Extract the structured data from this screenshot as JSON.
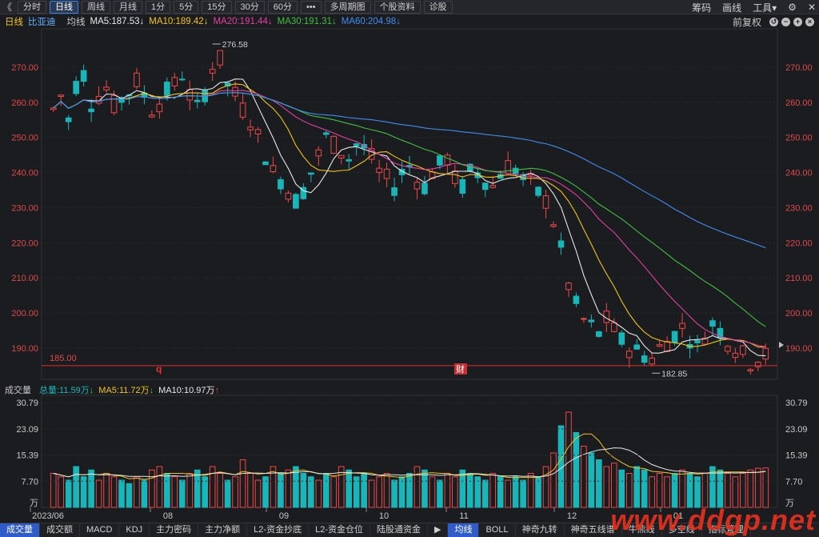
{
  "toolbar": {
    "back": "《",
    "tabs": [
      {
        "label": "分时",
        "active": false
      },
      {
        "label": "日线",
        "active": true
      },
      {
        "label": "周线",
        "active": false
      },
      {
        "label": "月线",
        "active": false
      },
      {
        "label": "1分",
        "active": false
      },
      {
        "label": "5分",
        "active": false
      },
      {
        "label": "15分",
        "active": false
      },
      {
        "label": "30分",
        "active": false
      },
      {
        "label": "60分",
        "active": false
      },
      {
        "label": "•••",
        "active": false
      },
      {
        "label": "多周期图",
        "active": false
      },
      {
        "label": "个股资料",
        "active": false
      },
      {
        "label": "诊股",
        "active": false
      }
    ],
    "right": [
      "筹码",
      "画线",
      "工具▾"
    ],
    "settings_icon": "gear-icon",
    "close_icon": "close-icon"
  },
  "ma_bar": {
    "period": "日线",
    "stock": "比亚迪",
    "avg_label": "均线",
    "items": [
      {
        "text": "MA5:187.53",
        "color": "#e8e8e8",
        "arrow": "↓"
      },
      {
        "text": "MA10:189.42",
        "color": "#f0c419",
        "arrow": "↓"
      },
      {
        "text": "MA20:191.44",
        "color": "#e040a0",
        "arrow": "↓"
      },
      {
        "text": "MA30:191.31",
        "color": "#40c040",
        "arrow": "↓"
      },
      {
        "text": "MA60:204.98",
        "color": "#3e8ef0",
        "arrow": "↓"
      }
    ],
    "adjust": "前复权",
    "tool_icons": [
      "undo-icon",
      "minus-icon",
      "plus-icon",
      "close-icon"
    ]
  },
  "price_axis": {
    "ticks": [
      "270.00",
      "260.00",
      "250.00",
      "240.00",
      "230.00",
      "220.00",
      "210.00",
      "200.00",
      "190.00"
    ],
    "high_label": "276.58",
    "low_label": "182.85",
    "support_label": "185.00",
    "marker_q": "q",
    "marker_cai": "财"
  },
  "volume_bar": {
    "title": "成交量",
    "total": "总量:11.59万",
    "total_arrow": "↓",
    "ma5": "MA5:11.72万",
    "ma5_arrow": "↓",
    "ma10": "MA10:10.97万",
    "ma10_arrow": "↑",
    "ticks": [
      "30.79",
      "23.09",
      "15.39",
      "7.70"
    ],
    "unit": "万"
  },
  "x_axis": [
    "2023/06",
    "08",
    "09",
    "10",
    "11",
    "12",
    "01"
  ],
  "colors": {
    "up": "#f04848",
    "down": "#19b6b9",
    "ma5": "#e8e8e8",
    "ma10": "#f0c419",
    "ma20": "#e040a0",
    "ma30": "#40c040",
    "ma60": "#3e8ef0",
    "accent": "#2f5cc8"
  },
  "bottom_tabs": [
    {
      "label": "成交量",
      "active": true
    },
    {
      "label": "成交额",
      "active": false
    },
    {
      "label": "MACD",
      "active": false
    },
    {
      "label": "KDJ",
      "active": false
    },
    {
      "label": "主力密码",
      "active": false
    },
    {
      "label": "主力净额",
      "active": false
    },
    {
      "label": "L2-资金抄底",
      "active": false
    },
    {
      "label": "L2-资金仓位",
      "active": false
    },
    {
      "label": "陆股通资金",
      "active": false
    },
    {
      "label": "▶",
      "active": false
    },
    {
      "label": "均线",
      "active": true
    },
    {
      "label": "BOLL",
      "active": false
    },
    {
      "label": "神奇九转",
      "active": false
    },
    {
      "label": "神奇五线谱",
      "active": false
    },
    {
      "label": "牛熊线",
      "active": false
    },
    {
      "label": "多空线",
      "active": false
    },
    {
      "label": "指标管理",
      "active": false
    }
  ],
  "watermark": "www.ddgp.net",
  "chart_data": {
    "type": "candlestick",
    "price_ylim": [
      182,
      280
    ],
    "volume_ylim": [
      0,
      32
    ],
    "price_path": [
      258,
      262,
      255,
      265,
      268,
      260,
      262,
      264,
      259,
      261,
      263,
      266,
      262,
      258,
      260,
      263,
      265,
      268,
      262,
      258,
      263,
      270,
      272,
      265,
      262,
      258,
      255,
      250,
      245,
      240,
      238,
      235,
      232,
      235,
      240,
      245,
      250,
      248,
      246,
      244,
      248,
      247,
      244,
      240,
      238,
      236,
      240,
      242,
      238,
      236,
      240,
      242,
      244,
      238,
      236,
      240,
      240,
      238,
      236,
      240,
      242,
      241,
      238,
      237,
      234,
      232,
      226,
      218,
      208,
      202,
      198,
      196,
      194,
      198,
      195,
      192,
      190,
      189,
      188,
      187,
      190,
      192,
      194,
      196,
      193,
      190,
      194,
      197,
      195,
      192,
      190,
      188,
      186,
      187,
      188
    ],
    "volume_path": [
      10,
      9,
      8,
      12,
      9,
      11,
      8,
      10,
      9,
      8,
      7,
      9,
      8,
      11,
      12,
      10,
      9,
      8,
      10,
      11,
      9,
      12,
      10,
      8,
      9,
      14,
      10,
      8,
      9,
      12,
      10,
      11,
      12,
      10,
      9,
      8,
      10,
      9,
      12,
      11,
      9,
      10,
      8,
      9,
      10,
      8,
      9,
      10,
      12,
      11,
      9,
      8,
      10,
      9,
      11,
      10,
      9,
      8,
      10,
      9,
      8,
      9,
      8,
      10,
      9,
      12,
      16,
      24,
      28,
      22,
      18,
      16,
      14,
      12,
      13,
      11,
      10,
      12,
      11,
      9,
      10,
      9,
      10,
      11,
      10,
      9,
      10,
      12,
      11,
      10,
      9,
      10,
      11,
      11.5,
      11.6
    ]
  }
}
